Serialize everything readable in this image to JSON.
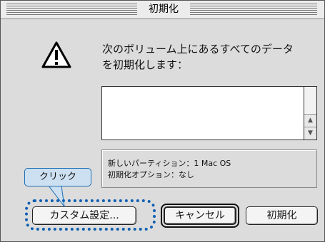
{
  "dialog": {
    "title": "初期化",
    "message_line1": "次のボリューム上にあるすべてのデータ",
    "message_line2": "を初期化します：",
    "warning_icon": "warning-triangle-icon"
  },
  "volume_list": {
    "items": []
  },
  "info": {
    "line1": "新しいパーティション：1 Mac OS",
    "line2": "初期化オプション：なし"
  },
  "buttons": {
    "custom_label": "カスタム設定...",
    "cancel_label": "キャンセル",
    "initialize_label": "初期化"
  },
  "annotation": {
    "callout_label": "クリック",
    "highlight_color": "#0d5fb3",
    "callout_bg": "#cde0f1"
  }
}
